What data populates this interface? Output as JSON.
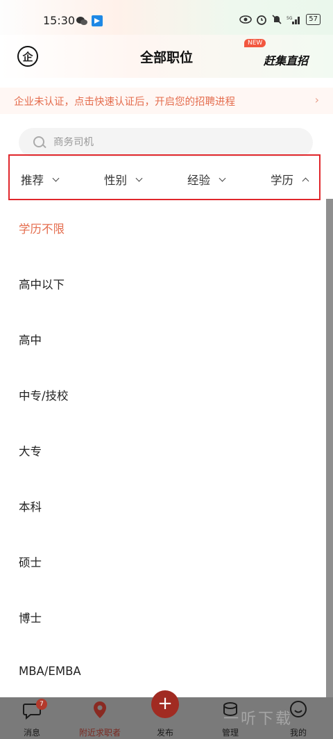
{
  "status": {
    "time": "15:30",
    "battery": "57"
  },
  "header": {
    "title": "全部职位",
    "new_badge": "NEW",
    "ganji_label": "赶集直招",
    "logo_glyph": "企"
  },
  "banner": {
    "text": "企业未认证，点击快速认证后，开启您的招聘进程",
    "chevron": "›"
  },
  "search": {
    "placeholder": "商务司机"
  },
  "filters": [
    {
      "label": "推荐",
      "state": "collapsed"
    },
    {
      "label": "性别",
      "state": "collapsed"
    },
    {
      "label": "经验",
      "state": "collapsed"
    },
    {
      "label": "学历",
      "state": "expanded"
    }
  ],
  "education_options": [
    {
      "label": "学历不限",
      "selected": true
    },
    {
      "label": "高中以下",
      "selected": false
    },
    {
      "label": "高中",
      "selected": false
    },
    {
      "label": "中专/技校",
      "selected": false
    },
    {
      "label": "大专",
      "selected": false
    },
    {
      "label": "本科",
      "selected": false
    },
    {
      "label": "硕士",
      "selected": false
    },
    {
      "label": "博士",
      "selected": false
    },
    {
      "label": "MBA/EMBA",
      "selected": false
    }
  ],
  "bottom_nav": [
    {
      "label": "消息",
      "icon": "message-icon",
      "badge": "7"
    },
    {
      "label": "附近求职者",
      "icon": "location-person-icon"
    },
    {
      "label": "发布",
      "icon": "plus-icon"
    },
    {
      "label": "管理",
      "icon": "manage-icon"
    },
    {
      "label": "我的",
      "icon": "profile-icon"
    }
  ],
  "watermark": "一听下载",
  "colors": {
    "accent": "#e46c4d",
    "highlight_border": "#e0262b",
    "nav_accent": "#a12b22"
  }
}
